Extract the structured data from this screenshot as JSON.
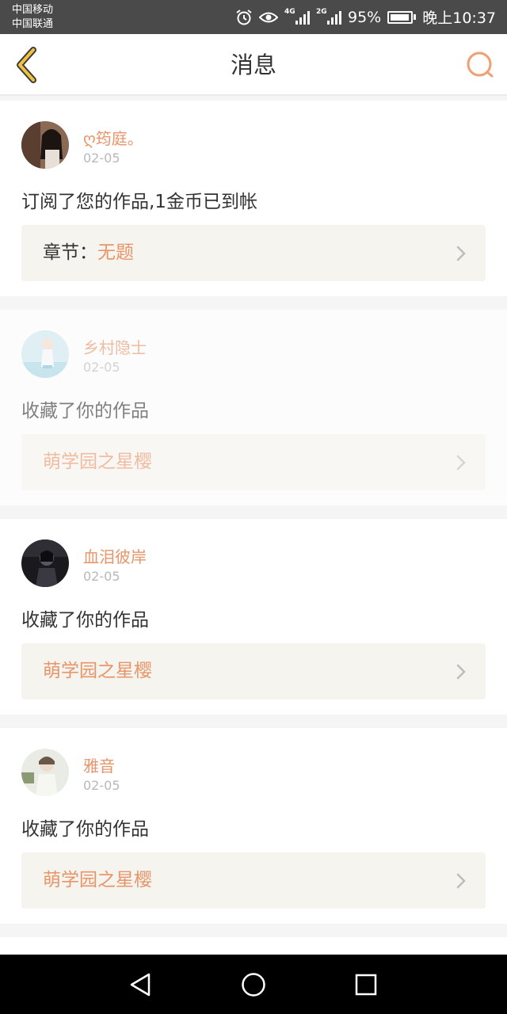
{
  "status_bar": {
    "carrier_1": "中国移动",
    "carrier_2": "中国联通",
    "network_1": "4G",
    "network_2": "2G",
    "battery_percent": "95%",
    "battery_level": 0.95,
    "time": "晚上10:37",
    "icons": [
      "alarm-icon",
      "eye-icon",
      "signal-icon",
      "battery-icon"
    ]
  },
  "header": {
    "title": "消息",
    "back_icon": "chevron-left-icon",
    "search_icon": "search-icon"
  },
  "colors": {
    "accent": "#e8956a",
    "back_icon": "#f0c040",
    "text": "#333333",
    "muted": "#b9b9b9",
    "link_bg": "#f5f4ef"
  },
  "messages": [
    {
      "username": "ღ筠庭。",
      "date": "02-05",
      "text": "订阅了您的作品,1金币已到帐",
      "link_prefix": "章节：",
      "link_title": "无题"
    },
    {
      "username": "乡村隐士",
      "date": "02-05",
      "text": "收藏了你的作品",
      "link_prefix": "",
      "link_title": "萌学园之星樱"
    },
    {
      "username": "血泪彼岸",
      "date": "02-05",
      "text": "收藏了你的作品",
      "link_prefix": "",
      "link_title": "萌学园之星樱"
    },
    {
      "username": "雅音",
      "date": "02-05",
      "text": "收藏了你的作品",
      "link_prefix": "",
      "link_title": "萌学园之星樱"
    }
  ],
  "nav_bar": {
    "buttons": [
      "back-triangle-icon",
      "home-circle-icon",
      "recents-square-icon"
    ]
  }
}
